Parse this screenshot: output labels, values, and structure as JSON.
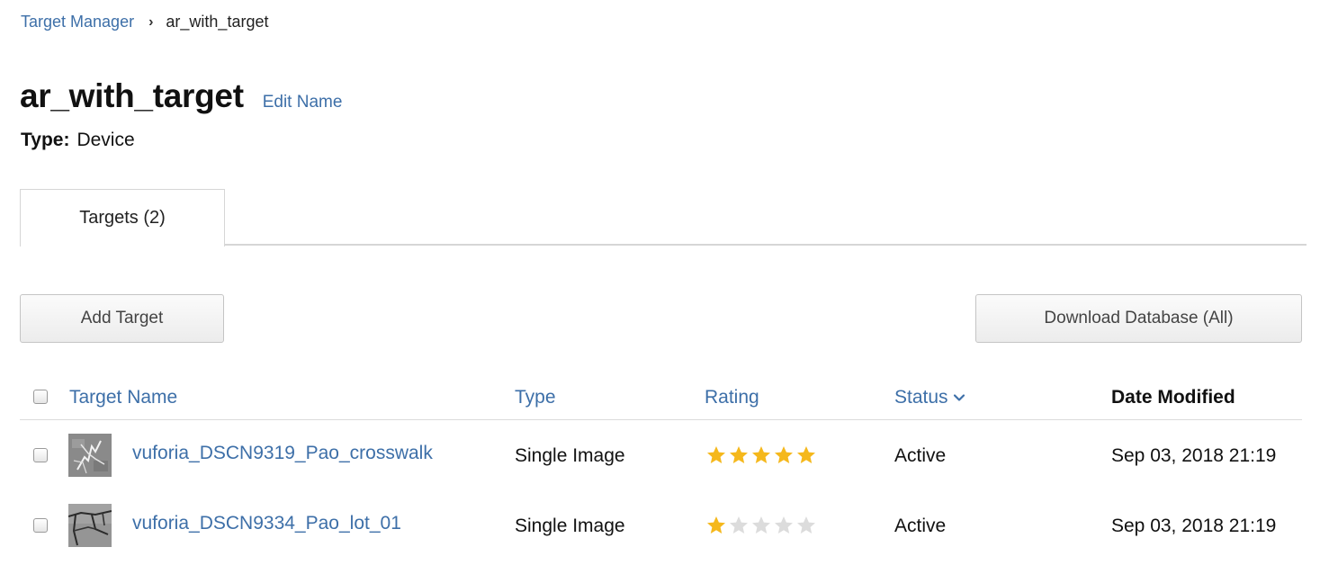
{
  "breadcrumb": {
    "parent": "Target Manager",
    "separator": "›",
    "current": "ar_with_target"
  },
  "header": {
    "title": "ar_with_target",
    "edit_label": "Edit Name",
    "type_label": "Type:",
    "type_value": "Device"
  },
  "tabs": [
    {
      "label": "Targets (2)",
      "active": true
    }
  ],
  "actions": {
    "add_label": "Add Target",
    "download_label": "Download Database (All)"
  },
  "table": {
    "columns": {
      "name": "Target Name",
      "type": "Type",
      "rating": "Rating",
      "status": "Status",
      "date": "Date Modified"
    },
    "sort_icon": "chevron-down-icon",
    "rows": [
      {
        "name": "vuforia_DSCN9319_Pao_crosswalk",
        "type": "Single Image",
        "rating": 5,
        "status": "Active",
        "date": "Sep 03, 2018 21:19"
      },
      {
        "name": "vuforia_DSCN9334_Pao_lot_01",
        "type": "Single Image",
        "rating": 1,
        "status": "Active",
        "date": "Sep 03, 2018 21:19"
      }
    ]
  },
  "colors": {
    "link": "#3d6fa8",
    "star_filled": "#f5b81c",
    "star_empty": "#dcdcdc"
  }
}
